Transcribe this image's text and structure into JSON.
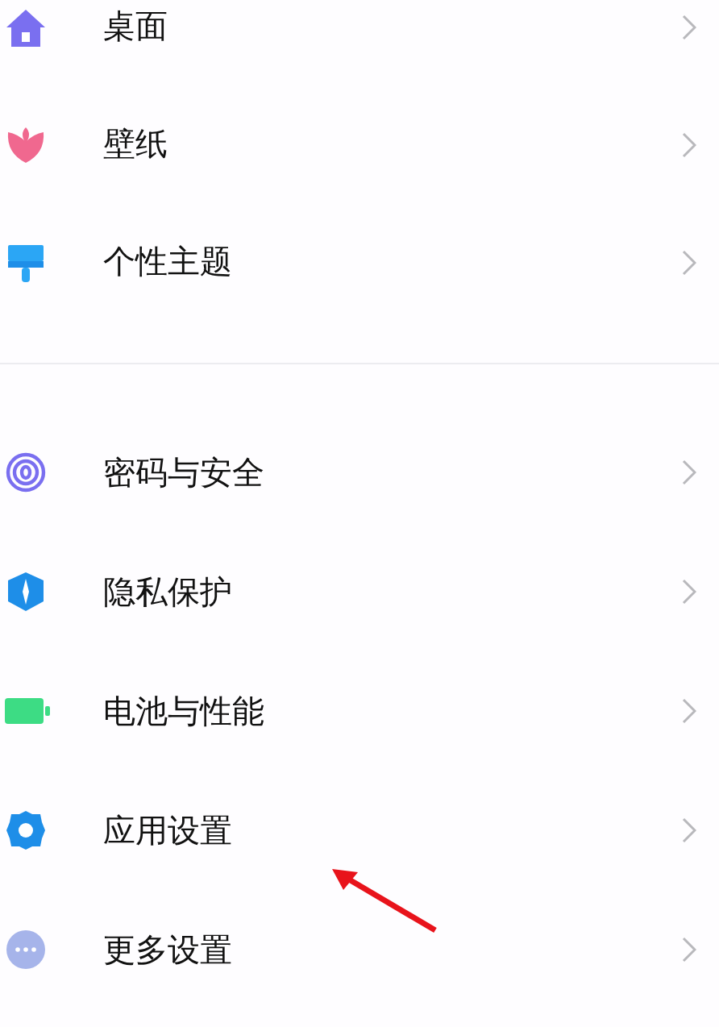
{
  "sections": [
    {
      "items": [
        {
          "label": "桌面"
        },
        {
          "label": "壁纸"
        },
        {
          "label": "个性主题"
        }
      ]
    },
    {
      "items": [
        {
          "label": "密码与安全"
        },
        {
          "label": "隐私保护"
        },
        {
          "label": "电池与性能"
        },
        {
          "label": "应用设置"
        },
        {
          "label": "更多设置"
        }
      ]
    }
  ]
}
